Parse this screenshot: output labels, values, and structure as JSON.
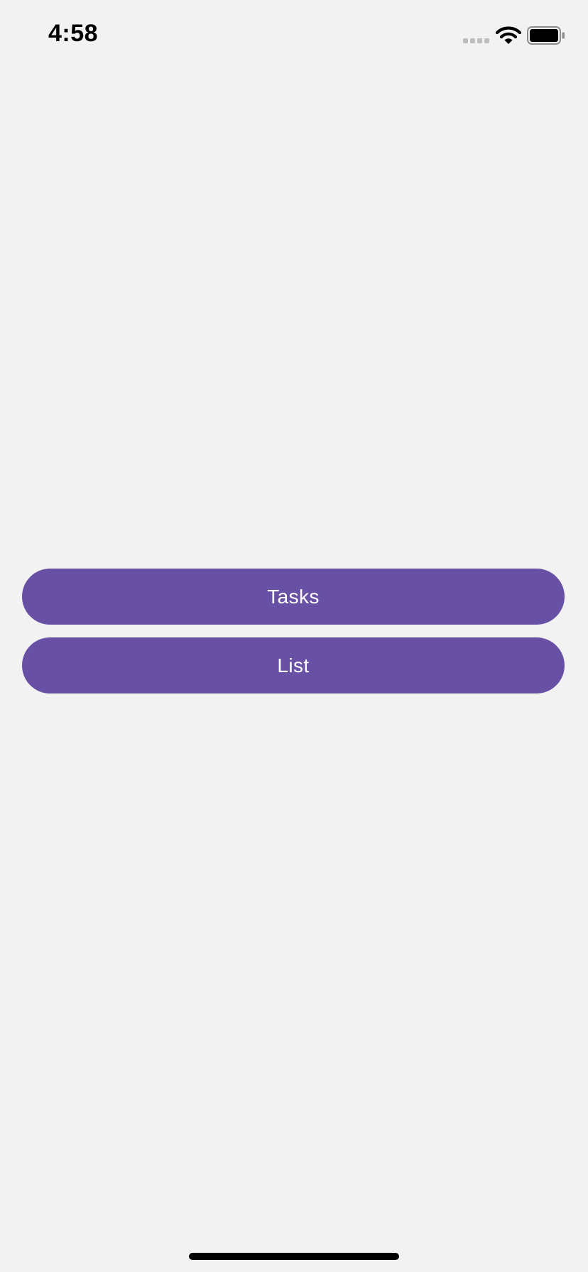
{
  "status_bar": {
    "time": "4:58",
    "icons": [
      "signal-icon",
      "wifi-icon",
      "battery-icon"
    ]
  },
  "buttons": [
    {
      "label": "Tasks"
    },
    {
      "label": "List"
    }
  ],
  "colors": {
    "background": "#f2f2f2",
    "button": "#6851a4",
    "button_text": "#ffffff"
  }
}
